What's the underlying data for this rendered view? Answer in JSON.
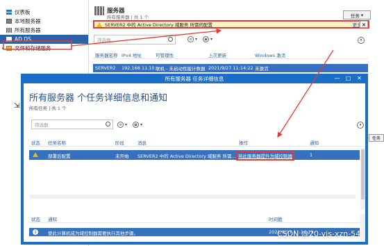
{
  "sidebar": {
    "items": [
      {
        "label": "仪表板",
        "icon": "dashboard-icon"
      },
      {
        "label": "本地服务器",
        "icon": "server-icon"
      },
      {
        "label": "所有服务器",
        "icon": "servers-icon"
      },
      {
        "label": "AD DS",
        "icon": "ad-ds-icon"
      },
      {
        "label": "文件和存储服务",
        "icon": "folder-icon"
      }
    ]
  },
  "background": {
    "title": "服务器",
    "subtitle": "所有服务器 | 共 1 个",
    "tasks_label": "任务",
    "notification": {
      "text": "SERVER2 中的 Active Directory 域服务 所需的配置",
      "more": "更多...",
      "close": "×"
    },
    "filter_placeholder": "筛选器",
    "columns": [
      "服务器名称",
      "IPv4 地址",
      "可管理性",
      "上次更新",
      "Windows 激活"
    ],
    "row": {
      "name": "SERVER2",
      "ip": "192.168.11.10",
      "manageability": "联机 - 未启动性能计数器",
      "last_update": "2021/9/27 11:14:22",
      "activation": "未激活"
    },
    "lower_tasks_label": "任务"
  },
  "dialog": {
    "window_title": "所有服务器 任务详细信息",
    "heading": "所有服务器 个任务详细信息和通知",
    "subtitle": "所有任务 | 共 1 个",
    "filter_placeholder": "筛选器",
    "task_columns": [
      "状态",
      "任务名称",
      "阶段",
      "消息",
      "操作",
      "通知"
    ],
    "task_row": {
      "name": "部署后配置",
      "stage": "未开始",
      "message": "SERVER2 中的 Active Directory 域服务 所需...",
      "action": "将此服务器提升为域控制器",
      "notifications": "1"
    },
    "detail_columns": [
      "状态",
      "通知",
      "时间戳"
    ],
    "detail_row": {
      "text": "使此计算机成为域控制器需要执行其他步骤。",
      "timestamp": "2021/9/27 11:14:19"
    }
  },
  "watermark": "CSDN @20-yjs-xzn-54",
  "colors": {
    "selection_blue": "#3770bd",
    "annotation_red": "#e53935",
    "warning_yellow": "#f1b81d"
  }
}
